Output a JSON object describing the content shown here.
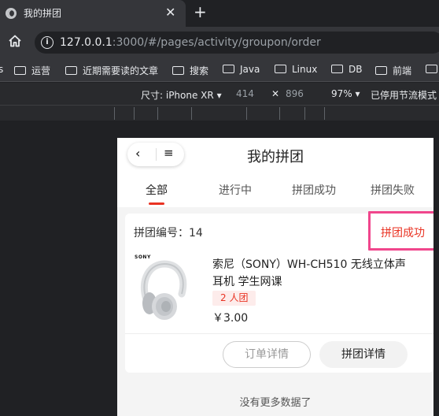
{
  "browser": {
    "tab_title": "我的拼团",
    "tab_close": "✕",
    "new_tab": "+",
    "url_host": "127.0.0.1",
    "url_rest": ":3000/#/pages/activity/groupon/order",
    "info_glyph": "i",
    "bookmarks": [
      "运营",
      "近期需要读的文章",
      "搜索",
      "Java",
      "Linux",
      "DB",
      "前端"
    ],
    "bookmark_lead": "s"
  },
  "devtools": {
    "device_label": "尺寸: iPhone XR",
    "width": "414",
    "times": "✕",
    "height": "896",
    "zoom": "97%",
    "throttle": "已停用节流模式"
  },
  "app": {
    "title": "我的拼团",
    "back_glyph": "‹",
    "menu_glyph": "≡",
    "tabs": [
      {
        "label": "全部",
        "active": true
      },
      {
        "label": "进行中",
        "active": false
      },
      {
        "label": "拼团成功",
        "active": false
      },
      {
        "label": "拼团失败",
        "active": false
      }
    ],
    "order": {
      "number_label": "拼团编号：14",
      "status": "拼团成功",
      "product_name": "索尼（SONY）WH-CH510 无线立体声耳机 学生网课",
      "brand_mark": "SONY",
      "group_badge": "2 人团",
      "price": "￥3.00",
      "order_detail_button": "订单详情",
      "group_detail_button": "拼团详情"
    },
    "footer_text": "没有更多数据了"
  },
  "colors": {
    "accent": "#e93323",
    "highlight_box": "#f0468c"
  }
}
